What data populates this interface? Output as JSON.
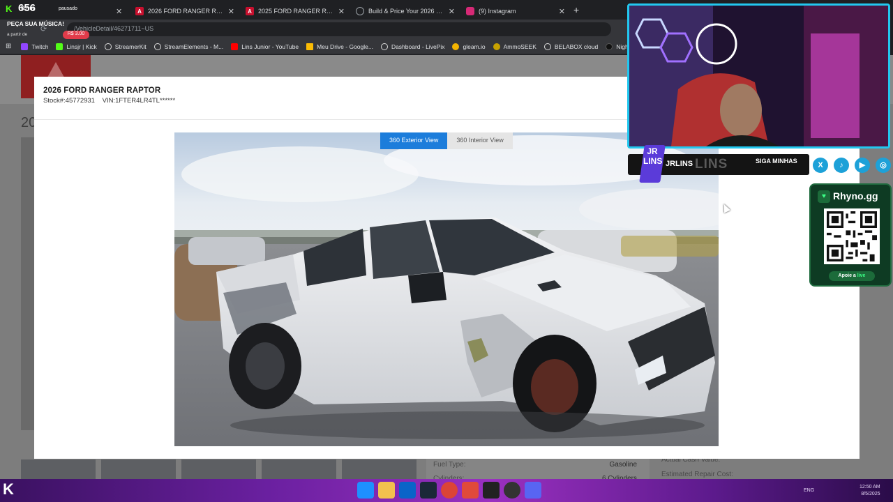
{
  "browser": {
    "tabs": [
      {
        "label": "PEÇA SUA MÚSICA!",
        "icon": "kick-icon",
        "color": "#53fc18",
        "active": false
      },
      {
        "label": "2026 FORD RANGER RAPTOR R",
        "icon": "iaa-icon",
        "color": "#c8102e",
        "active": true
      },
      {
        "label": "2025 FORD RANGER RAPTOR R",
        "icon": "iaa-icon",
        "color": "#c8102e",
        "active": false
      },
      {
        "label": "Build & Price Your 2026 Ford R",
        "icon": "globe-icon",
        "color": "#9aa0a6",
        "active": false
      },
      {
        "label": "(9) Instagram",
        "icon": "instagram-icon",
        "color": "#d62976",
        "active": false
      }
    ],
    "url": "/VehicleDetail/46271711~US",
    "bookmarks": [
      {
        "label": "Twitch",
        "color": "#9146ff"
      },
      {
        "label": "Linsjr | Kick",
        "color": "#53fc18"
      },
      {
        "label": "StreamerKit",
        "color": "#dddddd"
      },
      {
        "label": "StreamElements - M...",
        "color": "#dddddd"
      },
      {
        "label": "Lins Junior - YouTube",
        "color": "#ff0000"
      },
      {
        "label": "Meu Drive - Google...",
        "color": "#fbbc04"
      },
      {
        "label": "Dashboard - LivePix",
        "color": "#dddddd"
      },
      {
        "label": "gleam.io",
        "color": "#f4b400"
      },
      {
        "label": "AmmoSEEK",
        "color": "#c7a100"
      },
      {
        "label": "BELABOX cloud",
        "color": "#dddddd"
      },
      {
        "label": "Nightbot - Comm",
        "color": "#111111"
      }
    ]
  },
  "overlay": {
    "kick_count": "656",
    "music_title": "PEÇA SUA MÚSICA!",
    "music_sub": "a partir de",
    "price": "R$ 3.00",
    "paused": "pausado",
    "requester": "Rhyno"
  },
  "page": {
    "title_partial": "20",
    "fuel_type_label": "Fuel Type:",
    "fuel_type_value": "Gasoline",
    "cylinders_label": "Cylinders:",
    "cylinders_value": "6 Cylinders",
    "acv_label": "Actual Cash Value:",
    "erc_label": "Estimated Repair Cost:"
  },
  "modal": {
    "title": "2026 FORD RANGER RAPTOR",
    "stock": "Stock#:45772931",
    "vin": "VIN:1FTER4LR4TL******",
    "view_tabs": [
      {
        "label": "360 Exterior View",
        "active": true
      },
      {
        "label": "360 Interior View",
        "active": false
      }
    ]
  },
  "stream": {
    "channel_name": "JRLINS",
    "channel_ghost": "LINS",
    "logo_text": "JR LINS",
    "follow_label": "SIGA MINHAS",
    "socials": [
      {
        "icon": "x-icon",
        "glyph": "X",
        "color": "#1da1d8"
      },
      {
        "icon": "tiktok-icon",
        "glyph": "♪",
        "color": "#1da1d8"
      },
      {
        "icon": "youtube-icon",
        "glyph": "▶",
        "color": "#1da1d8"
      },
      {
        "icon": "instagram-icon",
        "glyph": "◎",
        "color": "#1da1d8"
      }
    ],
    "donation_title": "Rhyno.gg",
    "donation_button_prefix": "Apoie a ",
    "donation_button_highlight": "live"
  },
  "taskbar": {
    "lang": "ENG",
    "time": "12:50 AM",
    "date": "8/5/2025"
  }
}
